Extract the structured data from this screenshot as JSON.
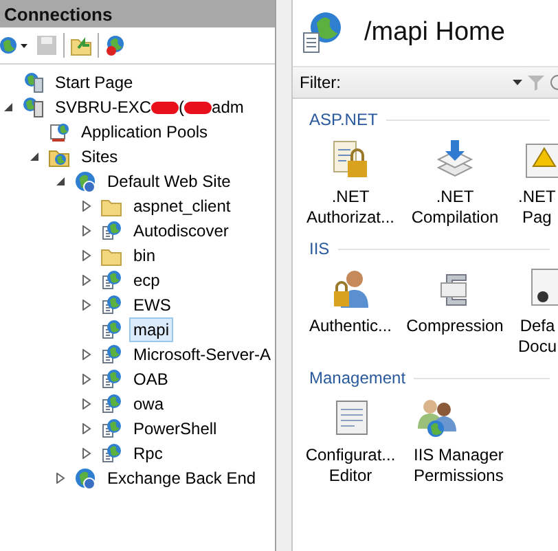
{
  "connections": {
    "title": "Connections",
    "tree": [
      {
        "kind": "start",
        "label_parts": [
          {
            "kind": "text",
            "text": "Start Page"
          }
        ],
        "selected": false
      },
      {
        "kind": "server",
        "label_parts": [
          {
            "kind": "text",
            "text": "SVBRU-EXC"
          },
          {
            "kind": "redaction"
          },
          {
            "kind": "text",
            "text": "("
          },
          {
            "kind": "redaction"
          },
          {
            "kind": "text",
            "text": "adm"
          }
        ],
        "selected": false,
        "expanded": true,
        "children": [
          {
            "kind": "pools",
            "label_parts": [
              {
                "kind": "text",
                "text": "Application Pools"
              }
            ],
            "selected": false
          },
          {
            "kind": "sites",
            "label_parts": [
              {
                "kind": "text",
                "text": "Sites"
              }
            ],
            "selected": false,
            "expanded": true,
            "children": [
              {
                "kind": "website",
                "label_parts": [
                  {
                    "kind": "text",
                    "text": "Default Web Site"
                  }
                ],
                "selected": false,
                "expanded": true,
                "children": [
                  {
                    "kind": "folder",
                    "label_parts": [
                      {
                        "kind": "text",
                        "text": "aspnet_client"
                      }
                    ],
                    "selected": false,
                    "expanded": false
                  },
                  {
                    "kind": "app",
                    "label_parts": [
                      {
                        "kind": "text",
                        "text": "Autodiscover"
                      }
                    ],
                    "selected": false,
                    "expanded": false
                  },
                  {
                    "kind": "folder",
                    "label_parts": [
                      {
                        "kind": "text",
                        "text": "bin"
                      }
                    ],
                    "selected": false,
                    "expanded": false
                  },
                  {
                    "kind": "app",
                    "label_parts": [
                      {
                        "kind": "text",
                        "text": "ecp"
                      }
                    ],
                    "selected": false,
                    "expanded": false
                  },
                  {
                    "kind": "app",
                    "label_parts": [
                      {
                        "kind": "text",
                        "text": "EWS"
                      }
                    ],
                    "selected": false,
                    "expanded": false
                  },
                  {
                    "kind": "app",
                    "label_parts": [
                      {
                        "kind": "text",
                        "text": "mapi"
                      }
                    ],
                    "selected": true
                  },
                  {
                    "kind": "app",
                    "label_parts": [
                      {
                        "kind": "text",
                        "text": "Microsoft-Server-A"
                      }
                    ],
                    "selected": false,
                    "expanded": false
                  },
                  {
                    "kind": "app",
                    "label_parts": [
                      {
                        "kind": "text",
                        "text": "OAB"
                      }
                    ],
                    "selected": false,
                    "expanded": false
                  },
                  {
                    "kind": "app",
                    "label_parts": [
                      {
                        "kind": "text",
                        "text": "owa"
                      }
                    ],
                    "selected": false,
                    "expanded": false
                  },
                  {
                    "kind": "app",
                    "label_parts": [
                      {
                        "kind": "text",
                        "text": "PowerShell"
                      }
                    ],
                    "selected": false,
                    "expanded": false
                  },
                  {
                    "kind": "app",
                    "label_parts": [
                      {
                        "kind": "text",
                        "text": "Rpc"
                      }
                    ],
                    "selected": false,
                    "expanded": false
                  }
                ]
              },
              {
                "kind": "website",
                "label_parts": [
                  {
                    "kind": "text",
                    "text": "Exchange Back End"
                  }
                ],
                "selected": false,
                "expanded": false
              }
            ]
          }
        ]
      }
    ]
  },
  "home": {
    "title": "/mapi Home",
    "filter": {
      "label": "Filter:"
    },
    "sections": [
      {
        "title": "ASP.NET",
        "items": [
          {
            "kind": "authorization",
            "lines": [
              ".NET",
              "Authorizat..."
            ]
          },
          {
            "kind": "compilation",
            "lines": [
              ".NET",
              "Compilation"
            ]
          },
          {
            "kind": "error-pages",
            "lines": [
              ".NET",
              "Pag"
            ]
          }
        ]
      },
      {
        "title": "IIS",
        "items": [
          {
            "kind": "authentication",
            "lines": [
              "Authentic..."
            ]
          },
          {
            "kind": "compression",
            "lines": [
              "Compression"
            ]
          },
          {
            "kind": "default-document",
            "lines": [
              "Defa",
              "Docu"
            ]
          }
        ]
      },
      {
        "title": "Management",
        "items": [
          {
            "kind": "config-editor",
            "lines": [
              "Configurat...",
              "Editor"
            ]
          },
          {
            "kind": "permissions",
            "lines": [
              "IIS Manager",
              "Permissions"
            ]
          }
        ]
      }
    ]
  }
}
